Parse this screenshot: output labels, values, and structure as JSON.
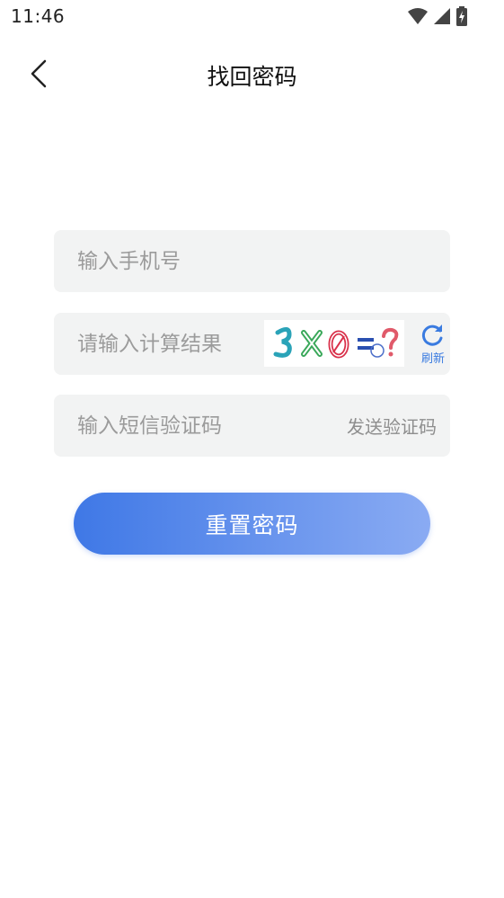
{
  "status_bar": {
    "time": "11:46",
    "icons": [
      "wifi-icon",
      "signal-icon",
      "battery-charging-icon"
    ]
  },
  "header": {
    "title": "找回密码",
    "back_icon": "chevron-left-icon"
  },
  "form": {
    "phone_placeholder": "输入手机号",
    "captcha_placeholder": "请输入计算结果",
    "captcha_image_text": "3×0=?",
    "refresh_label": "刷新",
    "sms_placeholder": "输入短信验证码",
    "send_code_label": "发送验证码"
  },
  "actions": {
    "reset_label": "重置密码"
  },
  "colors": {
    "accent_start": "#3f78e6",
    "accent_end": "#8aabf3",
    "field_bg": "#f2f3f3",
    "refresh_blue": "#3a7be0"
  }
}
